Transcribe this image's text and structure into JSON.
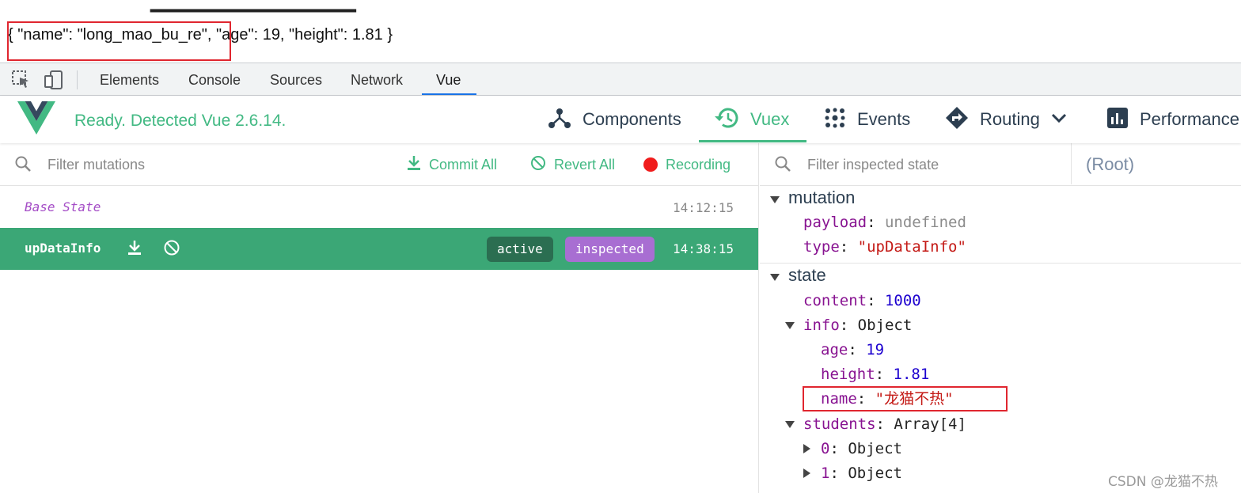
{
  "page": {
    "json_output": "{ \"name\": \"long_mao_bu_re\", \"age\": 19, \"height\": 1.81 }"
  },
  "devtools": {
    "tabs": [
      "Elements",
      "Console",
      "Sources",
      "Network",
      "Vue"
    ],
    "active_tab": "Vue"
  },
  "vue_header": {
    "status": "Ready. Detected Vue 2.6.14.",
    "nav": [
      {
        "label": "Components",
        "icon": "components-icon"
      },
      {
        "label": "Vuex",
        "icon": "history-icon"
      },
      {
        "label": "Events",
        "icon": "events-icon"
      },
      {
        "label": "Routing",
        "icon": "routing-icon"
      },
      {
        "label": "Performance",
        "icon": "performance-icon"
      }
    ],
    "active_nav": "Vuex",
    "accent_color": "#42b983"
  },
  "mutations_panel": {
    "filter_placeholder": "Filter mutations",
    "commit_all": "Commit All",
    "revert_all": "Revert All",
    "recording": "Recording",
    "base_state": {
      "name": "Base State",
      "time": "14:12:15"
    },
    "entries": [
      {
        "name": "upDataInfo",
        "tags": [
          "active",
          "inspected"
        ],
        "time": "14:38:15"
      }
    ]
  },
  "state_panel": {
    "filter_placeholder": "Filter inspected state",
    "root_label": "(Root)",
    "mutation": {
      "title": "mutation",
      "payload_key": "payload",
      "payload_value": "undefined",
      "type_key": "type",
      "type_value": "\"upDataInfo\""
    },
    "state": {
      "title": "state",
      "content_key": "content",
      "content_value": "1000",
      "info_key": "info",
      "info_value": "Object",
      "age_key": "age",
      "age_value": "19",
      "height_key": "height",
      "height_value": "1.81",
      "name_key": "name",
      "name_value": "\"龙猫不热\"",
      "students_key": "students",
      "students_value": "Array[4]",
      "s0_key": "0",
      "s0_value": "Object",
      "s1_key": "1",
      "s1_value": "Object"
    }
  },
  "watermark": "CSDN @龙猫不热"
}
